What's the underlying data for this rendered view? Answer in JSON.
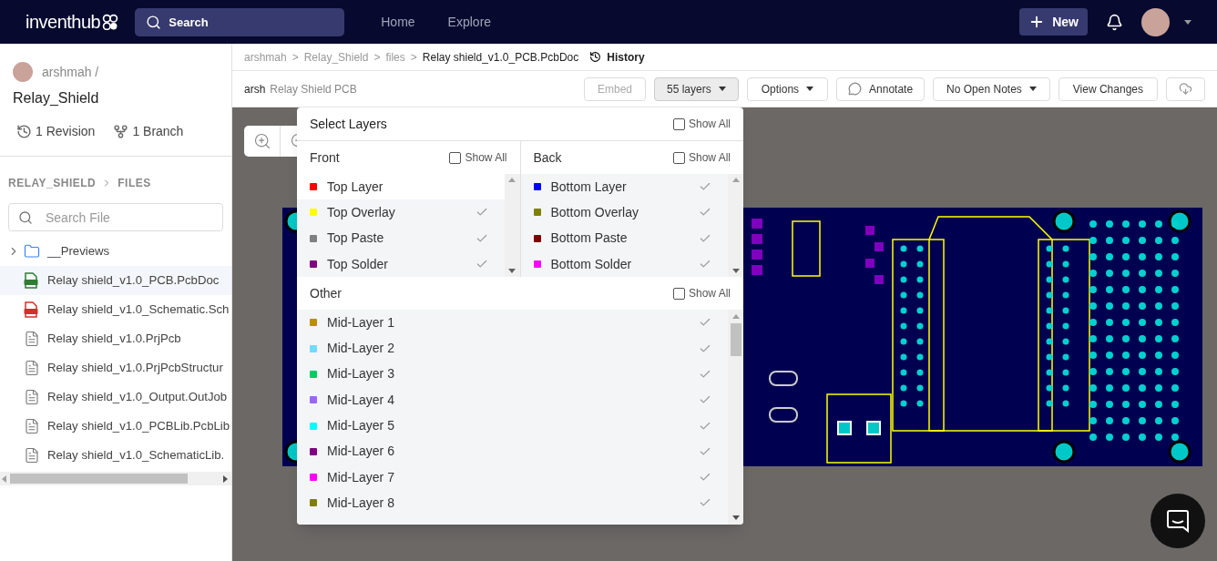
{
  "header": {
    "logo": "inventhub",
    "search": {
      "placeholder": "Search"
    },
    "nav": [
      {
        "label": "Home"
      },
      {
        "label": "Explore"
      }
    ],
    "new_button": "New"
  },
  "sidebar": {
    "owner": "arshmah /",
    "repo": "Relay_Shield",
    "revisions": "1 Revision",
    "branches": "1 Branch",
    "path": [
      "RELAY_SHIELD",
      "FILES"
    ],
    "search": {
      "placeholder": "Search File"
    },
    "files": [
      {
        "kind": "folder",
        "name": "__Previews",
        "selected": false
      },
      {
        "kind": "pcb",
        "name": "Relay shield_v1.0_PCB.PcbDoc",
        "selected": true
      },
      {
        "kind": "sch",
        "name": "Relay shield_v1.0_Schematic.Sch",
        "selected": false
      },
      {
        "kind": "doc",
        "name": "Relay shield_v1.0.PrjPcb",
        "selected": false
      },
      {
        "kind": "doc",
        "name": "Relay shield_v1.0.PrjPcbStructur",
        "selected": false
      },
      {
        "kind": "doc",
        "name": "Relay shield_v1.0_Output.OutJob",
        "selected": false
      },
      {
        "kind": "doc",
        "name": "Relay shield_v1.0_PCBLib.PcbLib",
        "selected": false
      },
      {
        "kind": "doc",
        "name": "Relay shield_v1.0_SchematicLib.",
        "selected": false
      }
    ]
  },
  "breadcrumb": {
    "parts": [
      "arshmah",
      "Relay_Shield",
      "files"
    ],
    "separator": ">",
    "current": "Relay shield_v1.0_PCB.PcbDoc",
    "history": "History"
  },
  "toolbar": {
    "user": "arsh",
    "title": "Relay Shield PCB",
    "embed": {
      "label": "Embed",
      "disabled": true
    },
    "layers": "55 layers",
    "options": "Options",
    "annotate": "Annotate",
    "notes": "No Open Notes",
    "view_changes": "View Changes"
  },
  "layers_panel": {
    "title": "Select Layers",
    "show_all_label": "Show All",
    "show_all": false,
    "front": {
      "title": "Front",
      "show_all_label": "Show All",
      "show_all": false,
      "layers": [
        {
          "name": "Top Layer",
          "color": "#ff0000",
          "visible": false
        },
        {
          "name": "Top Overlay",
          "color": "#ffff00",
          "visible": true
        },
        {
          "name": "Top Paste",
          "color": "#808080",
          "visible": true
        },
        {
          "name": "Top Solder",
          "color": "#800080",
          "visible": true
        }
      ]
    },
    "back": {
      "title": "Back",
      "show_all_label": "Show All",
      "show_all": false,
      "layers": [
        {
          "name": "Bottom Layer",
          "color": "#0000ff",
          "visible": true
        },
        {
          "name": "Bottom Overlay",
          "color": "#808000",
          "visible": true
        },
        {
          "name": "Bottom Paste",
          "color": "#800000",
          "visible": true
        },
        {
          "name": "Bottom Solder",
          "color": "#ff00ff",
          "visible": true
        }
      ]
    },
    "other": {
      "title": "Other",
      "show_all_label": "Show All",
      "show_all": false,
      "layers": [
        {
          "name": "Mid-Layer 1",
          "color": "#bc8e00",
          "visible": true
        },
        {
          "name": "Mid-Layer 2",
          "color": "#70dbff",
          "visible": true
        },
        {
          "name": "Mid-Layer 3",
          "color": "#00cc66",
          "visible": true
        },
        {
          "name": "Mid-Layer 4",
          "color": "#9966ff",
          "visible": true
        },
        {
          "name": "Mid-Layer 5",
          "color": "#00ffff",
          "visible": true
        },
        {
          "name": "Mid-Layer 6",
          "color": "#800080",
          "visible": true
        },
        {
          "name": "Mid-Layer 7",
          "color": "#ff00ff",
          "visible": true
        },
        {
          "name": "Mid-Layer 8",
          "color": "#808000",
          "visible": true
        }
      ]
    }
  }
}
